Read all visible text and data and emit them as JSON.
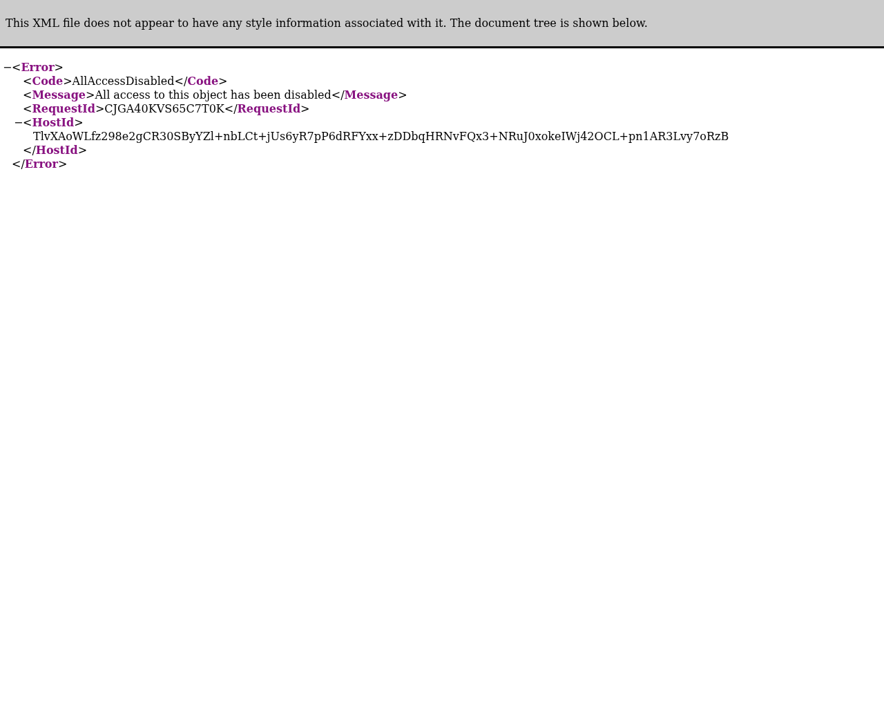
{
  "notice": "This XML file does not appear to have any style information associated with it. The document tree is shown below.",
  "tree": [
    {
      "toggle": "−",
      "open": "<**Error**>",
      "close": "</**Error**>",
      "children": [
        {
          "line": "<**Code**>AllAccessDisabled</**Code**>"
        },
        {
          "line": "<**Message**>All access to this object has been disabled</**Message**>"
        },
        {
          "line": "<**RequestId**>CJGA40KVS65C7T0K</**RequestId**>"
        },
        {
          "toggle": "−",
          "open": "<**HostId**>",
          "close": "</**HostId**>",
          "children": [
            {
              "line": "TlvXAoWLfz298e2gCR30SByYZl+nbLCt+jUs6yR7pP6dRFYxx+zDDbqHRNvFQx3+NRuJ0xokeIWj42OCL+pn1AR3Lvy7oRzB"
            }
          ]
        }
      ]
    }
  ]
}
